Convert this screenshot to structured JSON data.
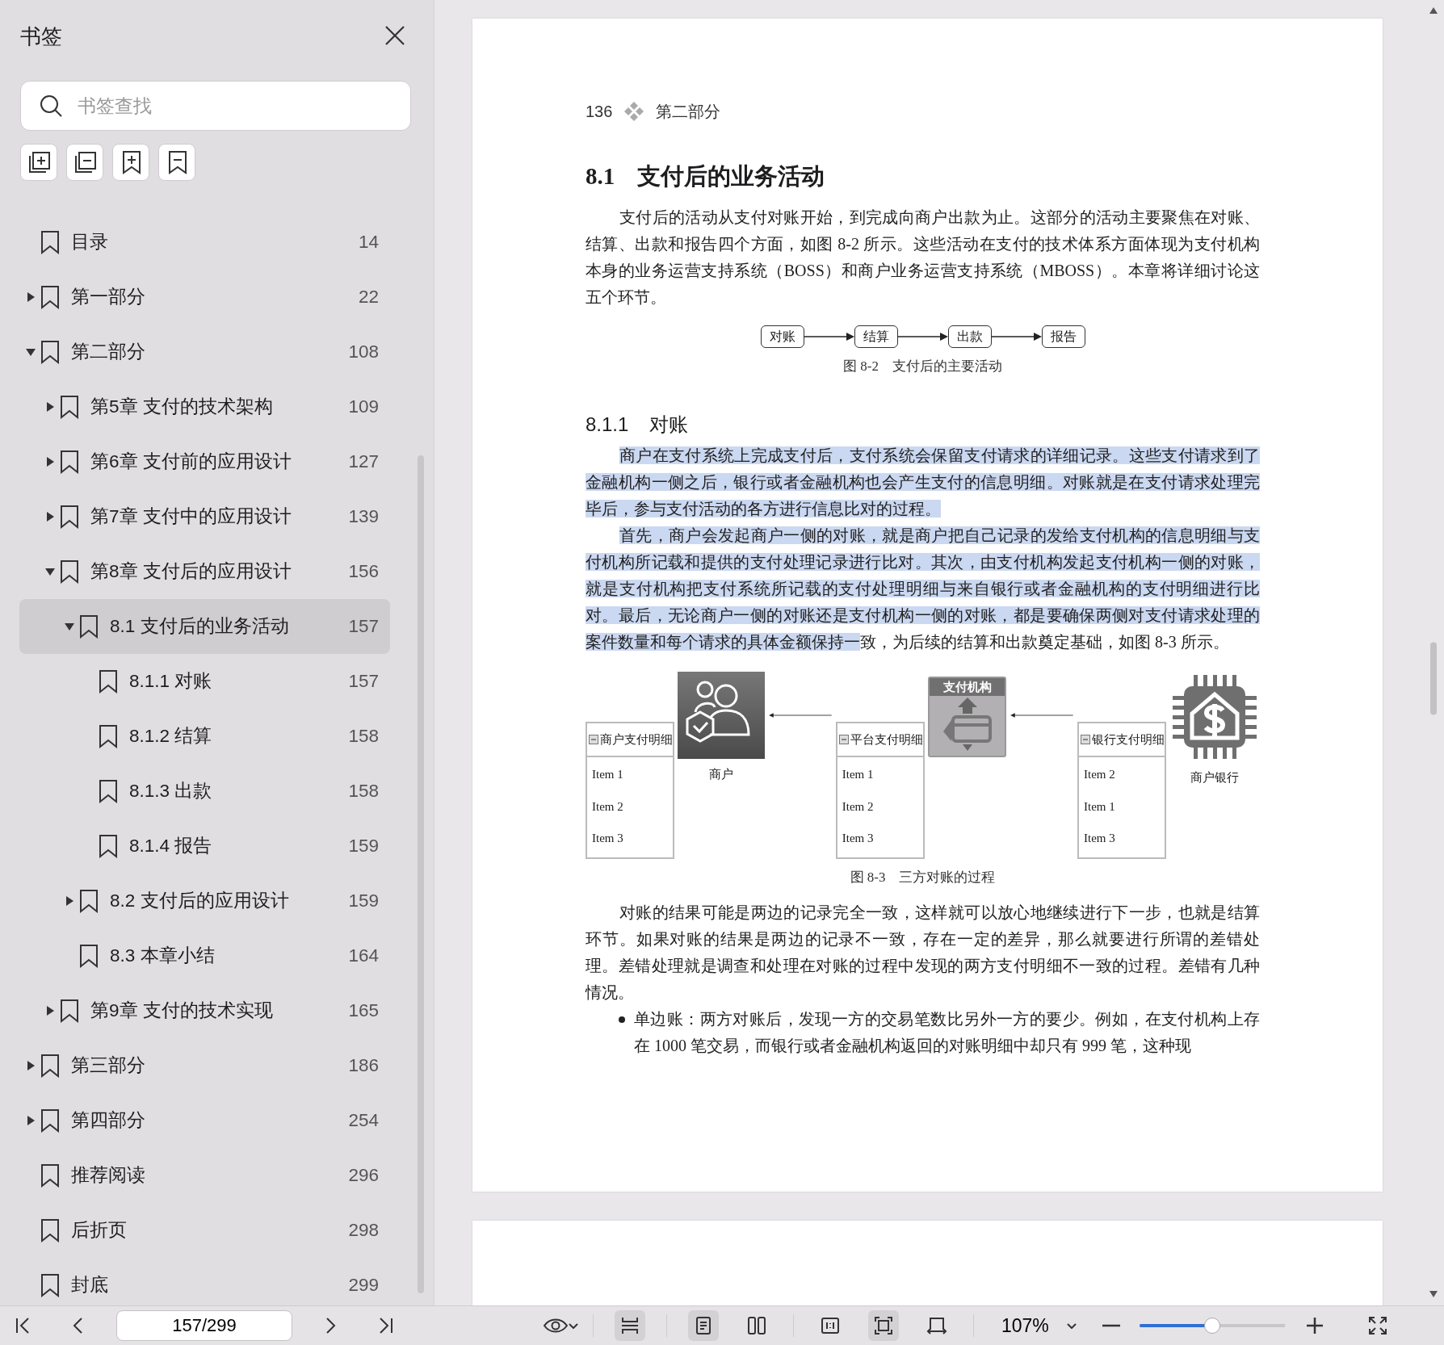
{
  "sidebar": {
    "title": "书签",
    "search": {
      "placeholder": "书签查找"
    },
    "tools": [
      {
        "kind": "expand-all"
      },
      {
        "kind": "collapse-all"
      },
      {
        "kind": "add"
      },
      {
        "kind": "remove"
      }
    ],
    "items": [
      {
        "title": "目录",
        "page": "14",
        "selected": false
      },
      {
        "title": "第一部分",
        "page": "22",
        "expanded": false,
        "selected": false
      },
      {
        "title": "第二部分",
        "page": "108",
        "expanded": true,
        "selected": false,
        "children": [
          {
            "title": "第5章 支付的技术架构",
            "page": "109",
            "expanded": false,
            "selected": false
          },
          {
            "title": "第6章 支付前的应用设计",
            "page": "127",
            "expanded": false,
            "selected": false
          },
          {
            "title": "第7章 支付中的应用设计",
            "page": "139",
            "expanded": false,
            "selected": false
          },
          {
            "title": "第8章 支付后的应用设计",
            "page": "156",
            "expanded": true,
            "selected": false,
            "children": [
              {
                "title": "8.1 支付后的业务活动",
                "page": "157",
                "expanded": true,
                "selected": true,
                "children": [
                  {
                    "title": "8.1.1 对账",
                    "page": "157",
                    "selected": false
                  },
                  {
                    "title": "8.1.2 结算",
                    "page": "158",
                    "selected": false
                  },
                  {
                    "title": "8.1.3 出款",
                    "page": "158",
                    "selected": false
                  },
                  {
                    "title": "8.1.4 报告",
                    "page": "159",
                    "selected": false
                  }
                ]
              },
              {
                "title": "8.2 支付后的应用设计",
                "page": "159",
                "expanded": false,
                "selected": false
              },
              {
                "title": "8.3 本章小结",
                "page": "164",
                "selected": false
              }
            ]
          },
          {
            "title": "第9章 支付的技术实现",
            "page": "165",
            "expanded": false,
            "selected": false
          }
        ]
      },
      {
        "title": "第三部分",
        "page": "186",
        "expanded": false,
        "selected": false
      },
      {
        "title": "第四部分",
        "page": "254",
        "expanded": false,
        "selected": false
      },
      {
        "title": "推荐阅读",
        "page": "296",
        "selected": false
      },
      {
        "title": "后折页",
        "page": "298",
        "selected": false
      },
      {
        "title": "封底",
        "page": "299",
        "selected": false
      }
    ]
  },
  "page": {
    "header": {
      "page_number": "136",
      "part": "第二部分"
    },
    "blocks": [
      {
        "kind": "heading",
        "number": "8.1",
        "title": "支付后的业务活动"
      },
      {
        "kind": "paragraph",
        "segments": [
          {
            "text": "支付后的活动从支付对账开始，到完成向商户出款为止。这部分的活动主要聚焦在对账、结算、出款和报告四个方面，如图 8-2 所示。这些活动在支付的技术体系方面体现为支付机构本身的业务运营支持系统（BOSS）和商户业务运营支持系统（MBOSS）。本章将详细讨论这五个环节。",
            "highlighted": false
          }
        ]
      },
      {
        "kind": "flow",
        "steps": [
          "对账",
          "结算",
          "出款",
          "报告"
        ],
        "caption": "图 8-2　支付后的主要活动"
      },
      {
        "kind": "subheading",
        "number": "8.1.1",
        "title": "对账"
      },
      {
        "kind": "paragraph",
        "segments": [
          {
            "text": "商户在支付系统上完成支付后，支付系统会保留支付请求的详细记录。这些支付请求到了金融机构一侧之后，银行或者金融机构也会产生支付的信息明细。对账就是在支付请求处理完毕后，参与支付活动的各方进行信息比对的过程。",
            "highlighted": true
          }
        ]
      },
      {
        "kind": "paragraph",
        "segments": [
          {
            "text": "首先，商户会发起商户一侧的对账，就是商户把自己记录的发给支付机构的信息明细与支付机构所记载和提供的支付处理记录进行比对。其次，由支付机构发起支付机构一侧的对账，就是支付机构把支付系统所记载的支付处理明细与来自银行或者金融机构的支付明细进行比对。最后，无论商户一侧的对账还是支付机构一侧的对账，都是要确保两侧对支付请求处理的案件数量和每个请求的具体金额保持一",
            "highlighted": true
          },
          {
            "text": "致，为后续的结算和出款奠定基础，如图 8-3 所示。",
            "highlighted": false
          }
        ]
      },
      {
        "kind": "reconciliation",
        "parties": [
          {
            "kind": "ledger",
            "title": "商户支付明细",
            "items": [
              "Item 1",
              "Item 2",
              "Item 3"
            ]
          },
          {
            "kind": "merchant",
            "label": "商户"
          },
          {
            "kind": "ledger",
            "title": "平台支付明细",
            "items": [
              "Item 1",
              "Item 2",
              "Item 3"
            ]
          },
          {
            "kind": "institution",
            "title": "支付机构"
          },
          {
            "kind": "ledger",
            "title": "银行支付明细",
            "items": [
              "Item 2",
              "Item 1",
              "Item 3"
            ]
          },
          {
            "kind": "bank",
            "label": "商户银行"
          }
        ],
        "caption": "图 8-3　三方对账的过程"
      },
      {
        "kind": "paragraph",
        "segments": [
          {
            "text": "对账的结果可能是两边的记录完全一致，这样就可以放心地继续进行下一步，也就是结算环节。如果对账的结果是两边的记录不一致，存在一定的差异，那么就要进行所谓的差错处理。差错处理就是调查和处理在对账的过程中发现的两方支付明细不一致的过程。差错有几种情况。",
            "highlighted": false
          }
        ]
      },
      {
        "kind": "bullet",
        "text": "单边账：两方对账后，发现一方的交易笔数比另外一方的要少。例如，在支付机构上存在 1000 笔交易，而银行或者金融机构返回的对账明细中却只有 999 笔，这种现"
      }
    ]
  },
  "toolbar": {
    "page_field": "157/299",
    "view_buttons": [
      {
        "kind": "continuous",
        "selected": true
      },
      {
        "kind": "single",
        "selected": true
      },
      {
        "kind": "double",
        "selected": false
      },
      {
        "kind": "actual",
        "selected": false
      },
      {
        "kind": "fit",
        "selected": true
      },
      {
        "kind": "width",
        "selected": false
      }
    ],
    "zoom": {
      "value": "107%",
      "level": 0.5
    }
  }
}
